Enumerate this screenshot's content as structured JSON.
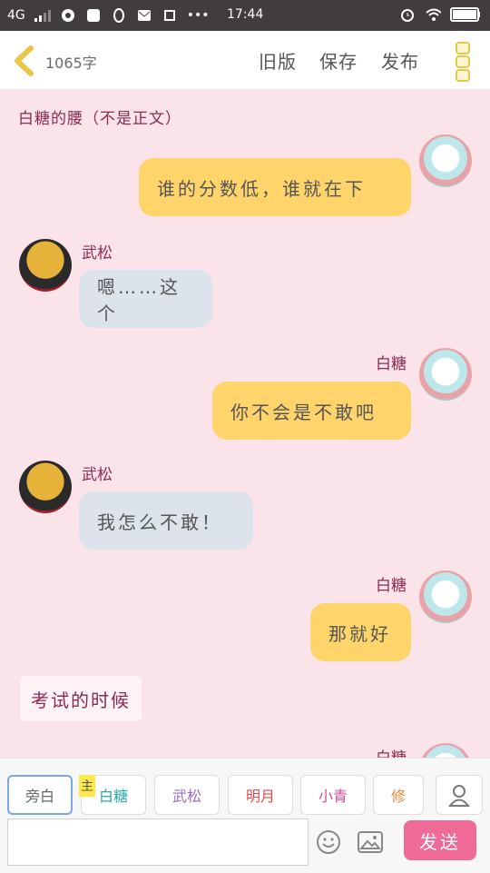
{
  "status_bar": {
    "network": "4G",
    "time": "17:44"
  },
  "header": {
    "word_count": "1065字",
    "buttons": {
      "old_version": "旧版",
      "save": "保存",
      "publish": "发布"
    }
  },
  "chat": {
    "title": "白糖的腰（不是正文）",
    "messages": [
      {
        "speaker": "白糖",
        "side": "right",
        "text": "谁的分数低，谁就在下"
      },
      {
        "speaker": "武松",
        "side": "left",
        "text": "嗯……这个"
      },
      {
        "speaker": "白糖",
        "side": "right",
        "text": "你不会是不敢吧"
      },
      {
        "speaker": "武松",
        "side": "left",
        "text": "我怎么不敢！"
      },
      {
        "speaker": "白糖",
        "side": "right",
        "text": "那就好"
      },
      {
        "speaker": "",
        "side": "narration",
        "text": "考试的时候"
      },
      {
        "speaker": "白糖",
        "side": "right",
        "text": ""
      }
    ]
  },
  "roles_bar": {
    "main_marker": "主",
    "chips": [
      {
        "label": "旁白",
        "color": "#666666"
      },
      {
        "label": "白糖",
        "color": "#2aa7a7"
      },
      {
        "label": "武松",
        "color": "#9a6cc7"
      },
      {
        "label": "明月",
        "color": "#e14b4b"
      },
      {
        "label": "小青",
        "color": "#d24b9a"
      },
      {
        "label": "修",
        "color": "#ef8a3a"
      }
    ]
  },
  "composer": {
    "input_value": "",
    "send_label": "发送"
  },
  "colors": {
    "accent": "#f06a98",
    "my_bubble": "#ffd46b",
    "other_bubble": "#dde3ea",
    "name_color": "#8a2a55"
  }
}
